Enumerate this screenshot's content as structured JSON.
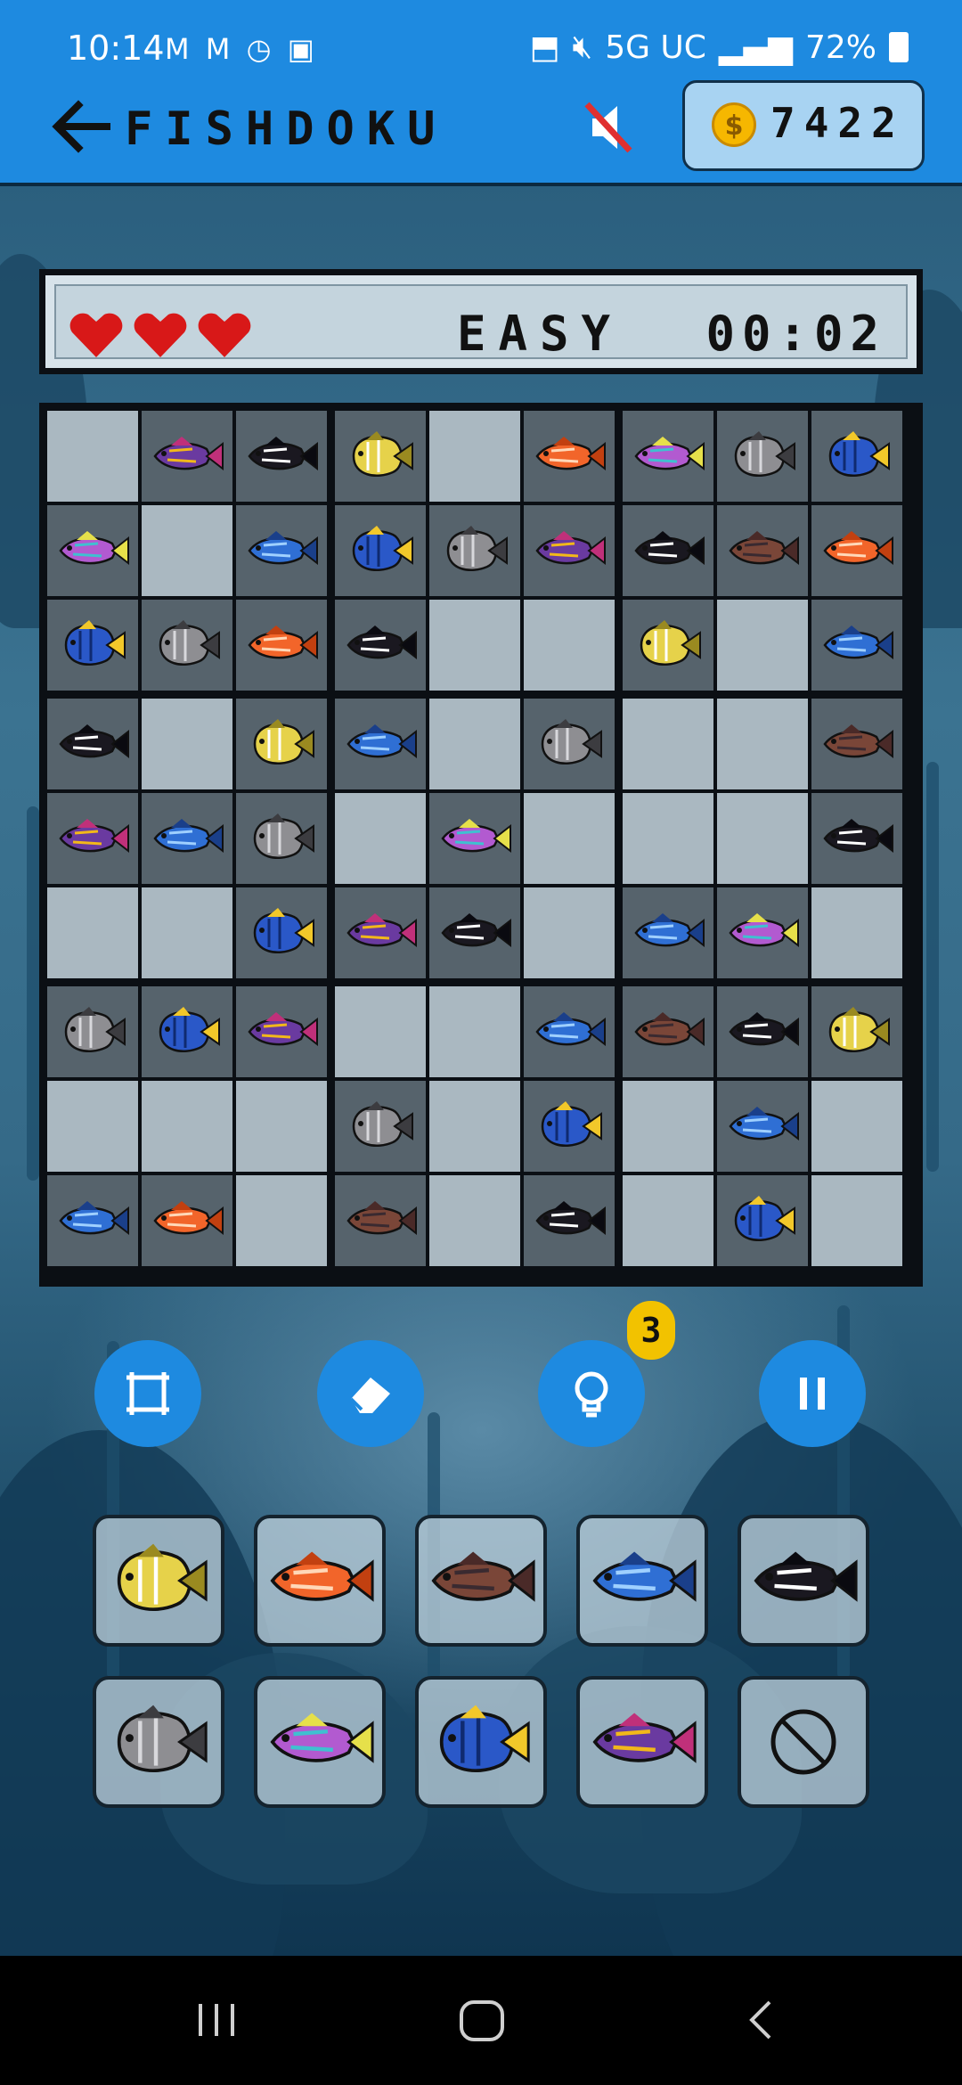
{
  "status_bar": {
    "time": "10:14",
    "left_icons": "M M ◷ ▣",
    "network": "5G UC",
    "battery": "72%"
  },
  "header": {
    "title": "FISHDOKU",
    "coins": "7422"
  },
  "info": {
    "lives": 3,
    "difficulty": "EASY",
    "timer": "00:02"
  },
  "fish_types": {
    "1": {
      "name": "butterflyfish",
      "body": "#e6d24a",
      "stripe": "#ffffff",
      "fin": "#9a8a20"
    },
    "2": {
      "name": "hawkfish",
      "body": "#f2652a",
      "stripe": "#ffd8b8",
      "fin": "#c24010"
    },
    "3": {
      "name": "brown-fish",
      "body": "#7a4638",
      "stripe": "#3a2a30",
      "fin": "#4a2a28"
    },
    "4": {
      "name": "blue-chromis",
      "body": "#2f6fd4",
      "stripe": "#9fd0ff",
      "fin": "#1a3f8a"
    },
    "5": {
      "name": "sweetlips",
      "body": "#1a1820",
      "stripe": "#ffffff",
      "fin": "#0a0a10"
    },
    "6": {
      "name": "grey-angelfish",
      "body": "#8e8e92",
      "stripe": "#d8d8dc",
      "fin": "#3c3c40"
    },
    "7": {
      "name": "wrasse",
      "body": "#b25ad0",
      "stripe": "#3fc0d0",
      "fin": "#e6e04a"
    },
    "8": {
      "name": "blue-tang",
      "body": "#2a58c8",
      "stripe": "#0f2a70",
      "fin": "#f2c82a"
    },
    "9": {
      "name": "royal-dottyback",
      "body": "#6a3aa0",
      "stripe": "#f2b81a",
      "fin": "#c0307a"
    }
  },
  "grid": [
    [
      0,
      9,
      5,
      1,
      0,
      2,
      7,
      6,
      8
    ],
    [
      7,
      0,
      4,
      8,
      6,
      9,
      5,
      3,
      2
    ],
    [
      8,
      6,
      2,
      5,
      0,
      0,
      1,
      0,
      4
    ],
    [
      5,
      0,
      1,
      4,
      0,
      6,
      0,
      0,
      3
    ],
    [
      9,
      4,
      6,
      0,
      7,
      0,
      0,
      0,
      5
    ],
    [
      0,
      0,
      8,
      9,
      5,
      0,
      4,
      7,
      0
    ],
    [
      6,
      8,
      9,
      0,
      0,
      4,
      3,
      5,
      1
    ],
    [
      0,
      0,
      0,
      6,
      0,
      8,
      0,
      4,
      0
    ],
    [
      4,
      2,
      0,
      3,
      0,
      5,
      0,
      8,
      0
    ]
  ],
  "tools": [
    "notes",
    "erase",
    "hint",
    "pause"
  ],
  "hint_count": "3",
  "palette": [
    1,
    2,
    3,
    4,
    5,
    6,
    7,
    8,
    9,
    0
  ]
}
